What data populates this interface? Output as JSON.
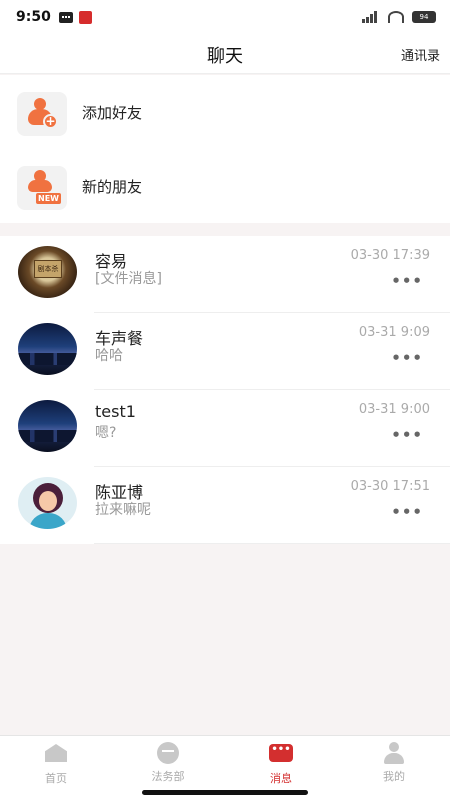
{
  "status_bar": {
    "time": "9:50",
    "icons": [
      "message-notification-icon",
      "app-notification-icon",
      "signal-icon",
      "wifi-icon",
      "battery-icon"
    ],
    "battery": "94"
  },
  "header": {
    "title": "聊天",
    "contacts_link": "通讯录"
  },
  "quick_actions": [
    {
      "label": "添加好友",
      "icon": "add-friend-icon"
    },
    {
      "label": "新的朋友",
      "icon": "new-friend-icon"
    }
  ],
  "new_badge": "NEW",
  "avatar_plaque": "剧本杀",
  "chats": [
    {
      "name": "容易",
      "preview": "[文件消息]",
      "time": "03-30 17:39",
      "avatar": "vintage-photo-avatar"
    },
    {
      "name": "车声餐",
      "preview": "哈哈",
      "time": "03-31 9:09",
      "avatar": "city-night-avatar"
    },
    {
      "name": "test1",
      "preview": "嗯?",
      "time": "03-31 9:00",
      "avatar": "city-night-avatar"
    },
    {
      "name": "陈亚博",
      "preview": "拉来嘛呢",
      "time": "03-30 17:51",
      "avatar": "cartoon-woman-avatar"
    }
  ],
  "more_glyph": "•••",
  "tabs": [
    {
      "label": "首页",
      "icon": "home-icon",
      "active": false
    },
    {
      "label": "法务部",
      "icon": "legal-icon",
      "active": false
    },
    {
      "label": "消息",
      "icon": "message-icon",
      "active": true
    },
    {
      "label": "我的",
      "icon": "profile-icon",
      "active": false
    }
  ],
  "colors": {
    "accent": "#d32f2f",
    "quick_icon_orange": "#f07240",
    "background": "#f7f3f3"
  }
}
